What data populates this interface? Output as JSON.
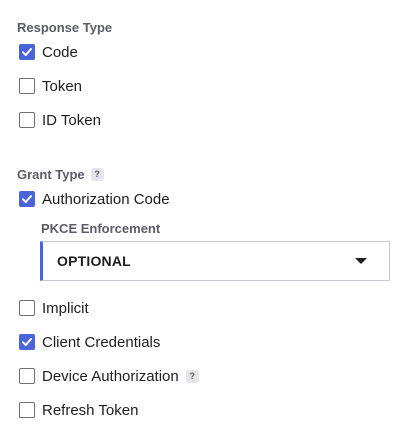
{
  "response_type": {
    "label": "Response Type",
    "options": [
      {
        "label": "Code",
        "checked": true
      },
      {
        "label": "Token",
        "checked": false
      },
      {
        "label": "ID Token",
        "checked": false
      }
    ]
  },
  "grant_type": {
    "label": "Grant Type",
    "help": "?",
    "authorization_code": {
      "label": "Authorization Code",
      "checked": true
    },
    "pkce": {
      "label": "PKCE Enforcement",
      "value": "OPTIONAL"
    },
    "implicit": {
      "label": "Implicit",
      "checked": false
    },
    "client_credentials": {
      "label": "Client Credentials",
      "checked": true
    },
    "device_authorization": {
      "label": "Device Authorization",
      "checked": false,
      "help": "?"
    },
    "refresh_token": {
      "label": "Refresh Token",
      "checked": false
    }
  },
  "colors": {
    "accent": "#4c64d9",
    "label": "#5c5c68"
  }
}
